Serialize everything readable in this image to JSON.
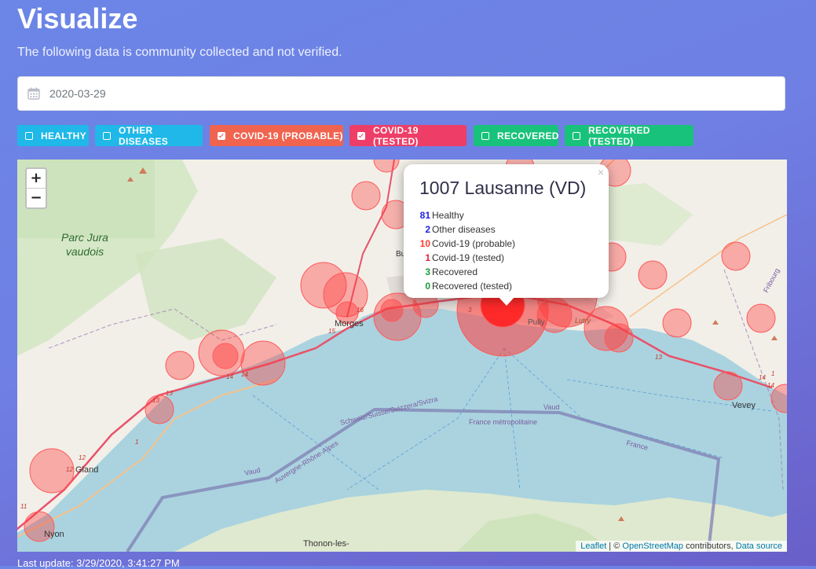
{
  "page": {
    "title": "Visualize",
    "subtitle": "The following data is community collected and not verified.",
    "date": "2020-03-29",
    "last_update": "Last update: 3/29/2020, 3:41:27 PM"
  },
  "filters": [
    {
      "label": "HEALTHY",
      "checked": false,
      "color": "#1fb8e8"
    },
    {
      "label": "OTHER DISEASES",
      "checked": false,
      "color": "#1fb8e8"
    },
    {
      "label": "COVID-19 (PROBABLE)",
      "checked": true,
      "color": "#f0644f"
    },
    {
      "label": "COVID-19 (TESTED)",
      "checked": true,
      "color": "#ee3e67"
    },
    {
      "label": "RECOVERED",
      "checked": false,
      "color": "#19c27b"
    },
    {
      "label": "RECOVERED (TESTED)",
      "checked": false,
      "color": "#19c27b"
    }
  ],
  "map": {
    "zoom_in": "+",
    "zoom_out": "−",
    "labels": {
      "parc_line1": "Parc Jura",
      "parc_line2": "vaudois",
      "morges": "Morges",
      "pully": "Pully",
      "lutry": "Lutry",
      "vevey": "Vevey",
      "gland": "Gland",
      "nyon": "Nyon",
      "thonon": "Thonon-les-",
      "bu": "Bu",
      "border": "Schweiz/Suisse/Svizzera/Svizra",
      "vaud1": "Vaud",
      "vaud2": "Vaud",
      "france_metro": "France métropolitaine",
      "france": "France",
      "auvergne": "Auvergne-Rhône-Alpes",
      "fribourg": "Fribourg"
    },
    "road_numbers": [
      "16",
      "15",
      "14",
      "14",
      "13",
      "13",
      "12",
      "12",
      "11",
      "1",
      "3",
      "13",
      "14",
      "14",
      "1"
    ],
    "popup": {
      "title": "1007 Lausanne (VD)",
      "close": "×",
      "rows": [
        {
          "count": "81",
          "label": "Healthy",
          "color": "#1f1fe0"
        },
        {
          "count": "2",
          "label": "Other diseases",
          "color": "#1f1fe0"
        },
        {
          "count": "10",
          "label": "Covid-19 (probable)",
          "color": "#ff3b30"
        },
        {
          "count": "1",
          "label": "Covid-19 (tested)",
          "color": "#e0203a"
        },
        {
          "count": "3",
          "label": "Recovered",
          "color": "#1a9a3c"
        },
        {
          "count": "0",
          "label": "Recovered (tested)",
          "color": "#1a9a3c"
        }
      ]
    },
    "attribution": {
      "leaflet": "Leaflet",
      "sep": " | © ",
      "osm": "OpenStreetMap",
      "contributors": " contributors, ",
      "source": "Data source"
    }
  }
}
